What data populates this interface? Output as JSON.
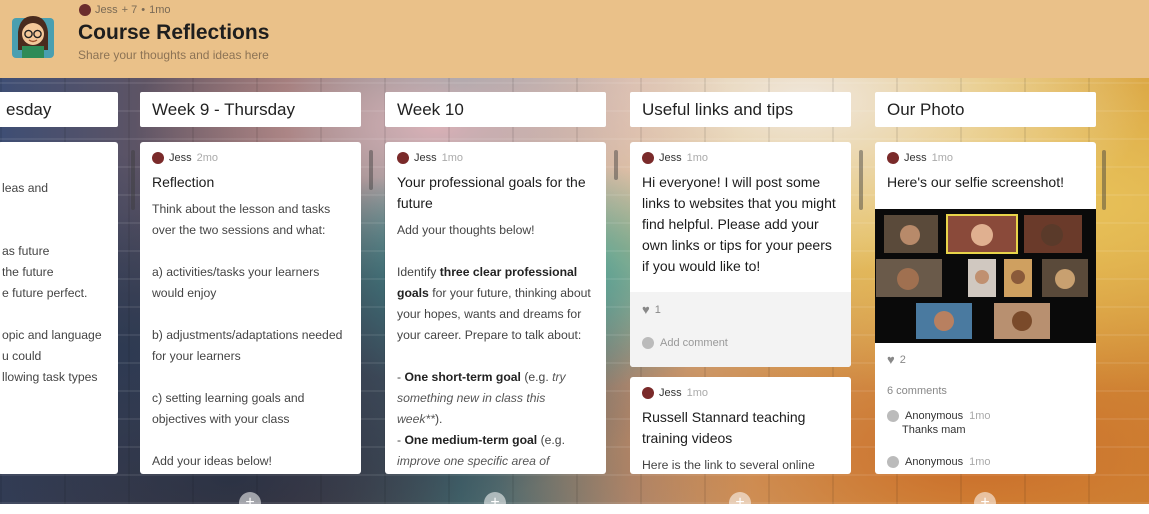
{
  "header": {
    "meta_author": "Jess",
    "meta_contrib": "+ 7",
    "meta_sep": "•",
    "meta_time": "1mo",
    "title": "Course Reflections",
    "subtitle": "Share your thoughts and ideas here"
  },
  "columns": [
    {
      "title": "esday"
    },
    {
      "title": "Week 9 - Thursday"
    },
    {
      "title": "Week 10"
    },
    {
      "title": "Useful links and tips"
    },
    {
      "title": "Our Photo"
    }
  ],
  "col0_card": {
    "lines": [
      "",
      "leas and",
      "",
      "",
      "as future",
      "the future",
      "e future perfect.",
      "",
      "opic and language",
      "u could",
      "llowing task types"
    ]
  },
  "col1_card": {
    "author": "Jess",
    "time": "2mo",
    "title": "Reflection",
    "p1": "Think about the lesson and tasks over the two sessions and what:",
    "p2": "a) activities/tasks your learners would enjoy",
    "p3": "b) adjustments/adaptations needed for your learners",
    "p4": "c) setting learning goals and objectives with your class",
    "p5": "Add your ideas below!"
  },
  "col2_card": {
    "author": "Jess",
    "time": "1mo",
    "title": "Your professional goals for the future",
    "p1": "Add your thoughts below!",
    "p2a": "Identify ",
    "p2b": "three clear professional goals",
    "p2c": " for your future, thinking about your hopes, wants and dreams for your career. Prepare to talk about:",
    "l1a": "- ",
    "l1b": "One short-term goal",
    "l1c": " (e.g. ",
    "l1d": "try something new in class this week**",
    "l1e": ").",
    "l2a": "- ",
    "l2b": "One medium-term goal",
    "l2c": " (e.g. ",
    "l2d": "improve one specific area of"
  },
  "col3_card1": {
    "author": "Jess",
    "time": "1mo",
    "title": "Hi everyone! I will post some links to websites that you might find helpful. Please add your own links or tips for your peers if you would like to!",
    "likes": "1",
    "add_comment": "Add comment"
  },
  "col3_card2": {
    "author": "Jess",
    "time": "1mo",
    "title": "Russell Stannard teaching training videos",
    "body": "Here is the link to several online"
  },
  "col4_card": {
    "author": "Jess",
    "time": "1mo",
    "title": "Here's our selfie screenshot!",
    "likes": "2",
    "comments_count": "6 comments",
    "c1_author": "Anonymous",
    "c1_time": "1mo",
    "c1_text": "Thanks mam",
    "c2_author": "Anonymous",
    "c2_time": "1mo"
  },
  "icons": {
    "add": "+"
  },
  "colors": {
    "header_bg": "#eac189",
    "card_bg": "#ffffff"
  }
}
